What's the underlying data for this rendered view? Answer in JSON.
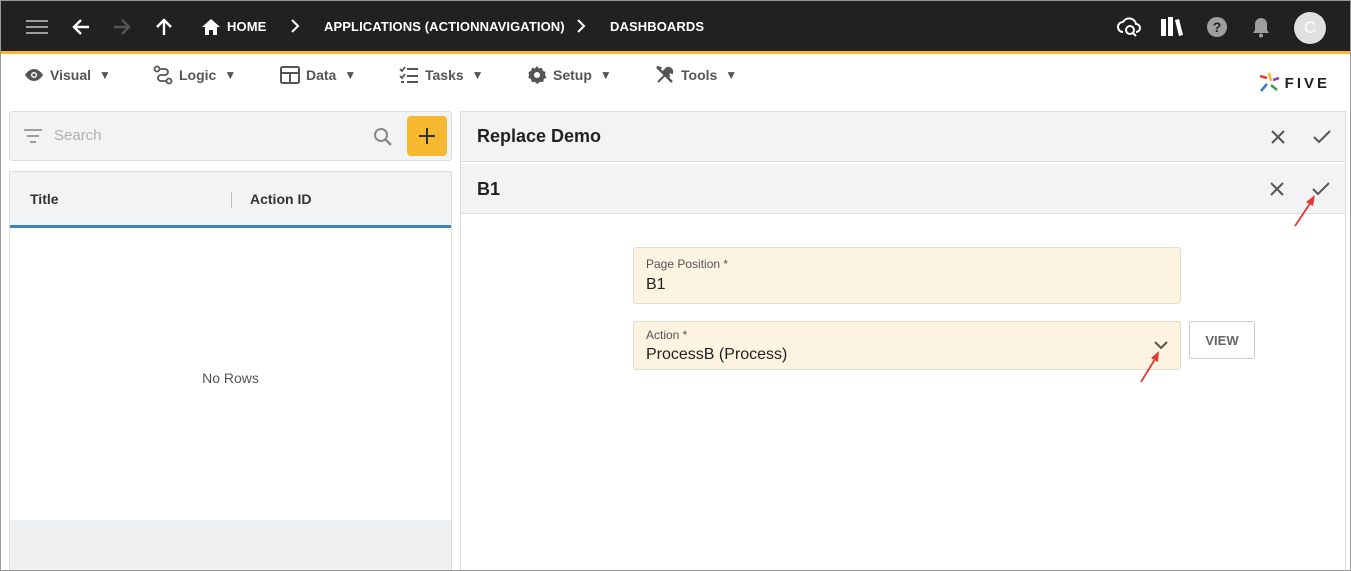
{
  "topbar": {
    "breadcrumbs": [
      "HOME",
      "APPLICATIONS (ACTIONNAVIGATION)",
      "DASHBOARDS"
    ],
    "avatar_initial": "C"
  },
  "menu": {
    "items": [
      {
        "label": "Visual",
        "icon": "eye-icon"
      },
      {
        "label": "Logic",
        "icon": "logic-icon"
      },
      {
        "label": "Data",
        "icon": "table-icon"
      },
      {
        "label": "Tasks",
        "icon": "tasks-icon"
      },
      {
        "label": "Setup",
        "icon": "gear-icon"
      },
      {
        "label": "Tools",
        "icon": "tools-icon"
      }
    ],
    "logo_text": "FIVE"
  },
  "list": {
    "search_placeholder": "Search",
    "columns": [
      "Title",
      "Action ID"
    ],
    "empty_text": "No Rows"
  },
  "form": {
    "title": "Replace Demo",
    "subtitle": "B1",
    "fields": {
      "page_position": {
        "label": "Page Position *",
        "value": "B1"
      },
      "action": {
        "label": "Action *",
        "value": "ProcessB (Process)"
      }
    },
    "view_label": "VIEW"
  },
  "colors": {
    "accent": "#f5b82e",
    "topbar": "#212121",
    "field_bg": "#fdf3e1",
    "list_header_underline": "#3f82c8",
    "annotation_arrow": "#e53935"
  }
}
